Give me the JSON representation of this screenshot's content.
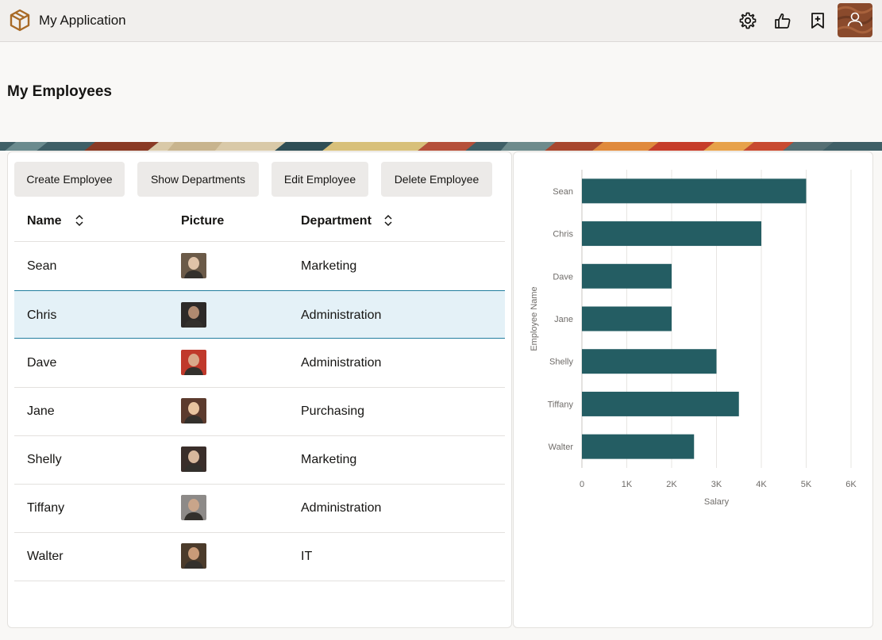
{
  "app": {
    "title": "My Application"
  },
  "topbar_icons": [
    "gear-icon",
    "thumbs-up-icon",
    "bookmark-add-icon",
    "user-avatar-icon"
  ],
  "page": {
    "title": "My Employees"
  },
  "toolbar": {
    "create_label": "Create Employee",
    "show_departments_label": "Show Departments",
    "edit_label": "Edit Employee",
    "delete_label": "Delete Employee"
  },
  "table": {
    "columns": [
      "Name",
      "Picture",
      "Department"
    ],
    "sortable_columns": [
      "Name",
      "Department"
    ],
    "selected_row": 1,
    "rows": [
      {
        "name": "Sean",
        "department": "Marketing"
      },
      {
        "name": "Chris",
        "department": "Administration"
      },
      {
        "name": "Dave",
        "department": "Administration"
      },
      {
        "name": "Jane",
        "department": "Purchasing"
      },
      {
        "name": "Shelly",
        "department": "Marketing"
      },
      {
        "name": "Tiffany",
        "department": "Administration"
      },
      {
        "name": "Walter",
        "department": "IT"
      }
    ]
  },
  "colors": {
    "bar": "#245d63",
    "selected_row_bg": "#e4f1f7",
    "selected_row_border": "#227e9e",
    "logo": "#a86a26"
  },
  "chart_data": {
    "type": "bar",
    "orientation": "horizontal",
    "categories": [
      "Sean",
      "Chris",
      "Dave",
      "Jane",
      "Shelly",
      "Tiffany",
      "Walter"
    ],
    "values": [
      5000,
      4000,
      2000,
      2000,
      3000,
      3500,
      2500
    ],
    "xlabel": "Salary",
    "ylabel": "Employee Name",
    "xlim": [
      0,
      6000
    ],
    "xticks": [
      "0",
      "1K",
      "2K",
      "3K",
      "4K",
      "5K",
      "6K"
    ],
    "grid": true,
    "legend": "none"
  }
}
